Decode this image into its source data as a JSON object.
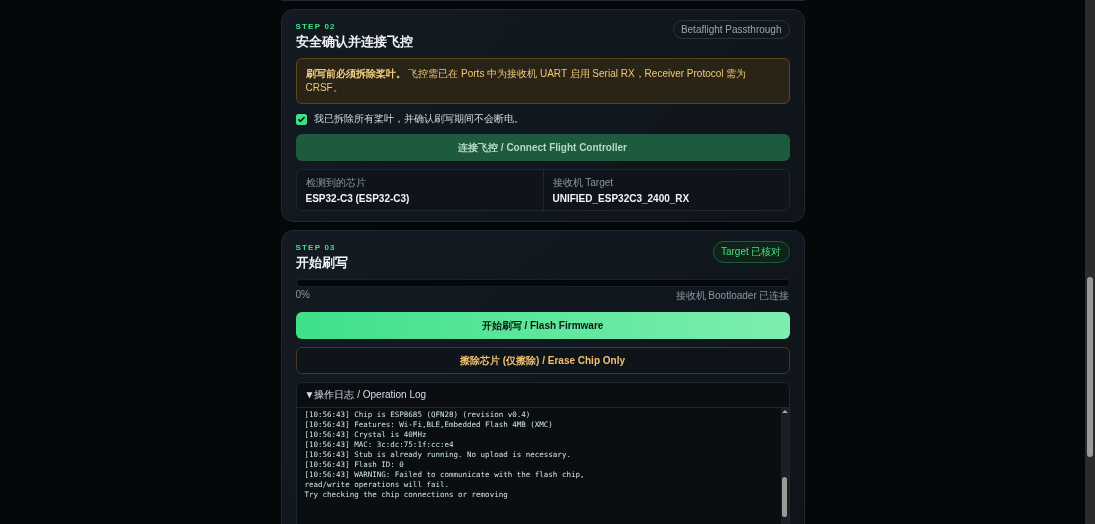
{
  "steps": [
    {
      "step": "STEP 02",
      "title": "安全确认并连接飞控",
      "badge": {
        "text": "Betaflight Passthrough",
        "kind": "neutral"
      },
      "warning": {
        "text": "**刷写前必须拆除桨叶。** 飞控需已在 Ports 中为接收机 UART 启用 Serial RX，Receiver Protocol 需为 CRSF。"
      },
      "checkbox": {
        "label": "我已拆除所有桨叶，并确认刷写期间不会断电。",
        "checked": true
      },
      "buttons": [
        {
          "label": "连接飞控 / Connect Flight Controller",
          "kind": "muted"
        }
      ],
      "info": [
        {
          "label": "检测到的芯片",
          "value": "ESP32-C3 (ESP32-C3)"
        },
        {
          "label": "接收机 Target",
          "value": "UNIFIED_ESP32C3_2400_RX"
        }
      ]
    },
    {
      "step": "STEP 03",
      "title": "开始刷写",
      "badge": {
        "text": "Target 已核对",
        "kind": "success"
      },
      "progress": {
        "level": 0,
        "reading": "0%",
        "status": "接收机 Bootloader 已连接"
      },
      "buttons": [
        {
          "label": "开始刷写 / Flash Firmware",
          "kind": "primary"
        },
        {
          "label": "擦除芯片 (仅擦除) / Erase Chip Only",
          "kind": "outline"
        }
      ],
      "log": {
        "title": "▼操作日志 / Operation Log",
        "expanded": true,
        "lines": [
          "[10:56:43] Chip is ESP8685 (QFN28) (revision v0.4)",
          "[10:56:43] Features: Wi-Fi,BLE,Embedded Flash 4MB (XMC)",
          "[10:56:43] Crystal is 40MHz",
          "[10:56:43] MAC: 3c:dc:75:1f:cc:e4",
          "[10:56:43] Stub is already running. No upload is necessary.",
          "[10:56:43] Flash ID: 0",
          "[10:56:43] WARNING: Failed to communicate with the flash chip,",
          "read/write operations will fail.",
          "Try checking the chip connections or removing"
        ]
      }
    }
  ]
}
